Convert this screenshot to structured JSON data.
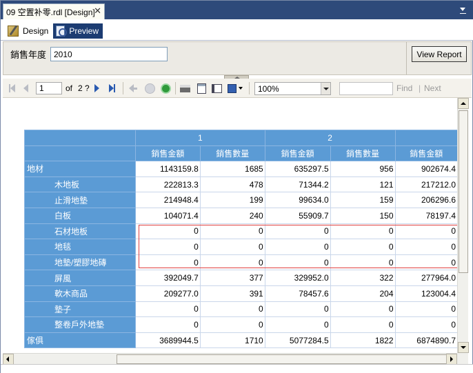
{
  "document_tab": {
    "title": "09 空置补零.rdl [Design]",
    "close": "✕"
  },
  "view_tabs": {
    "design": "Design",
    "preview": "Preview"
  },
  "parameters": {
    "label": "銷售年度",
    "value": "2010",
    "view_report": "View Report"
  },
  "toolbar": {
    "page_current": "1",
    "page_of": "of",
    "page_total": "2 ?",
    "zoom": "100%",
    "find_placeholder": "",
    "find": "Find",
    "find_sep": "|",
    "next": "Next"
  },
  "matrix": {
    "column_groups": [
      "1",
      "2",
      ""
    ],
    "measure_headers": [
      "銷售金額",
      "銷售數量",
      "銷售金額",
      "銷售數量",
      "銷售金額"
    ],
    "rows": [
      {
        "label": "地材",
        "level": 0,
        "values": [
          "1143159.8",
          "1685",
          "635297.5",
          "956",
          "902674.4"
        ]
      },
      {
        "label": "木地板",
        "level": 1,
        "values": [
          "222813.3",
          "478",
          "71344.2",
          "121",
          "217212.0"
        ]
      },
      {
        "label": "止滑地墊",
        "level": 1,
        "values": [
          "214948.4",
          "199",
          "99634.0",
          "159",
          "206296.6"
        ]
      },
      {
        "label": "白板",
        "level": 1,
        "values": [
          "104071.4",
          "240",
          "55909.7",
          "150",
          "78197.4"
        ]
      },
      {
        "label": "石材地板",
        "level": 1,
        "values": [
          "0",
          "0",
          "0",
          "0",
          "0"
        ]
      },
      {
        "label": "地毯",
        "level": 1,
        "values": [
          "0",
          "0",
          "0",
          "0",
          "0"
        ]
      },
      {
        "label": "地墊/塑膠地磚",
        "level": 1,
        "values": [
          "0",
          "0",
          "0",
          "0",
          "0"
        ]
      },
      {
        "label": "屏風",
        "level": 1,
        "values": [
          "392049.7",
          "377",
          "329952.0",
          "322",
          "277964.0"
        ]
      },
      {
        "label": "軟木商品",
        "level": 1,
        "values": [
          "209277.0",
          "391",
          "78457.6",
          "204",
          "123004.4"
        ]
      },
      {
        "label": "墊子",
        "level": 1,
        "values": [
          "0",
          "0",
          "0",
          "0",
          "0"
        ]
      },
      {
        "label": "整卷戶外地墊",
        "level": 1,
        "values": [
          "0",
          "0",
          "0",
          "0",
          "0"
        ]
      },
      {
        "label": "傢俱",
        "level": 0,
        "values": [
          "3689944.5",
          "1710",
          "5077284.5",
          "1822",
          "6874890.7"
        ]
      }
    ]
  },
  "icons": {
    "first": "first-page-icon",
    "prev": "previous-page-icon",
    "next": "next-page-icon",
    "last": "last-page-icon",
    "back": "back-icon",
    "stop": "stop-icon",
    "refresh": "refresh-icon",
    "print": "print-icon",
    "layout": "print-layout-icon",
    "setup": "page-setup-icon",
    "export": "export-icon"
  },
  "colors": {
    "header_blue": "#5b9bd5",
    "tab_active": "#1c3c72",
    "highlight_red": "#e04040"
  }
}
